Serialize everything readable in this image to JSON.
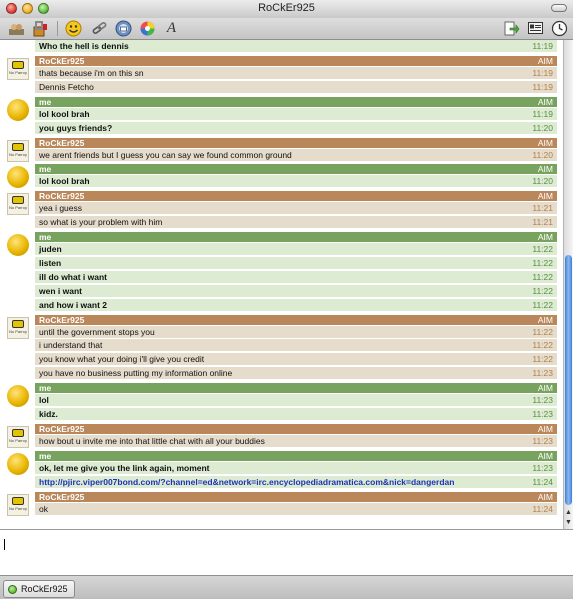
{
  "window": {
    "title": "RoCkEr925"
  },
  "toolbar": {
    "icons": [
      "user-info-icon",
      "block-icon",
      "smiley-icon",
      "link-icon",
      "mail-icon",
      "color-icon",
      "font-icon",
      "send-file-icon",
      "profile-icon",
      "history-icon"
    ],
    "font_glyph": "A"
  },
  "colors": {
    "me_header": "#78a35e",
    "them_header": "#b9875a",
    "me_row": "#dcebd2",
    "them_row": "#e6dccb",
    "link": "#1a33b8"
  },
  "chat": {
    "groups": [
      {
        "sender": "me",
        "name": "",
        "service": "",
        "avatar": false,
        "messages": [
          {
            "text": "Who the hell is dennis",
            "time": "11:19"
          }
        ]
      },
      {
        "sender": "them",
        "name": "RoCkEr925",
        "service": "AIM",
        "avatar": true,
        "avatar_label": "No Parroy",
        "messages": [
          {
            "text": "thats because i'm on this sn",
            "time": "11:19"
          },
          {
            "text": "Dennis Fetcho",
            "time": "11:19"
          }
        ]
      },
      {
        "sender": "me",
        "name": "me",
        "service": "AIM",
        "avatar": true,
        "messages": [
          {
            "text": "lol kool brah",
            "time": "11:19"
          },
          {
            "text": "you guys friends?",
            "time": "11:20"
          }
        ]
      },
      {
        "sender": "them",
        "name": "RoCkEr925",
        "service": "AIM",
        "avatar": true,
        "avatar_label": "No Parroy",
        "messages": [
          {
            "text": "we arent friends but I guess you can say we found common ground",
            "time": "11:20"
          }
        ]
      },
      {
        "sender": "me",
        "name": "me",
        "service": "AIM",
        "avatar": true,
        "messages": [
          {
            "text": "lol kool brah",
            "time": "11:20"
          }
        ]
      },
      {
        "sender": "them",
        "name": "RoCkEr925",
        "service": "AIM",
        "avatar": true,
        "avatar_label": "No Parroy",
        "messages": [
          {
            "text": "yea i guess",
            "time": "11:21"
          },
          {
            "text": "so what is your problem with him",
            "time": "11:21"
          }
        ]
      },
      {
        "sender": "me",
        "name": "me",
        "service": "AIM",
        "avatar": true,
        "messages": [
          {
            "text": "juden",
            "time": "11:22"
          },
          {
            "text": "listen",
            "time": "11:22"
          },
          {
            "text": "ill do what i want",
            "time": "11:22"
          },
          {
            "text": "wen i want",
            "time": "11:22"
          },
          {
            "text": "and how i want 2",
            "time": "11:22"
          }
        ]
      },
      {
        "sender": "them",
        "name": "RoCkEr925",
        "service": "AIM",
        "avatar": true,
        "avatar_label": "No Parroy",
        "messages": [
          {
            "text": "until the government stops you",
            "time": "11:22"
          },
          {
            "text": "i understand that",
            "time": "11:22"
          },
          {
            "text": "you know what your doing i'll give you credit",
            "time": "11:22"
          },
          {
            "text": "you have no business putting my information online",
            "time": "11:23"
          }
        ]
      },
      {
        "sender": "me",
        "name": "me",
        "service": "AIM",
        "avatar": true,
        "messages": [
          {
            "text": "lol",
            "time": "11:23"
          },
          {
            "text": "kidz.",
            "time": "11:23"
          }
        ]
      },
      {
        "sender": "them",
        "name": "RoCkEr925",
        "service": "AIM",
        "avatar": true,
        "avatar_label": "No Parroy",
        "messages": [
          {
            "text": "how bout u invite me into that little chat with all your buddies",
            "time": "11:23"
          }
        ]
      },
      {
        "sender": "me",
        "name": "me",
        "service": "AIM",
        "avatar": true,
        "messages": [
          {
            "text": "ok, let me give you the link again, moment",
            "time": "11:23"
          },
          {
            "text": "http://pjirc.viper007bond.com/?channel=ed&network=irc.encyclopediadramatica.com&nick=dangerdan",
            "time": "11:24",
            "link": true
          }
        ]
      },
      {
        "sender": "them",
        "name": "RoCkEr925",
        "service": "AIM",
        "avatar": true,
        "avatar_label": "No Parroy",
        "messages": [
          {
            "text": "ok",
            "time": "11:24"
          }
        ]
      }
    ]
  },
  "input": {
    "value": ""
  },
  "tabs": [
    {
      "label": "RoCkEr925"
    }
  ]
}
